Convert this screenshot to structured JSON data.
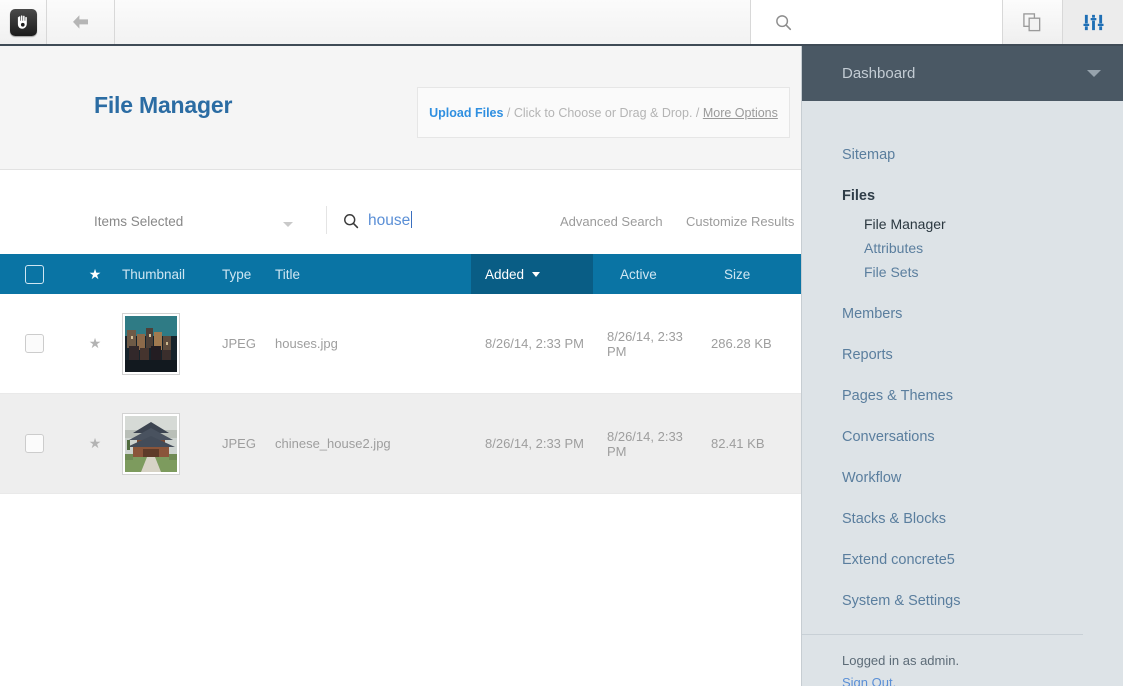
{
  "toolbar": {
    "logo_icon": "concrete5-hand-icon",
    "back_icon": "arrow-left-icon",
    "search_icon": "search-icon",
    "search_placeholder": "",
    "pages_icon": "copy-pages-icon",
    "settings_icon": "sliders-settings-icon",
    "accent_color": "#1f6fb5"
  },
  "page": {
    "title": "File Manager",
    "upload": {
      "link": "Upload Files",
      "separator_1": " / ",
      "hint": "Click to Choose or Drag & Drop.",
      "separator_2": " / ",
      "more": "More Options"
    }
  },
  "filters": {
    "items_selected_label": "Items Selected",
    "items_selected_caret": "chevron-down-icon",
    "search_icon": "search-icon",
    "search_value": "house",
    "advanced_search": "Advanced Search",
    "customize_results": "Customize Results"
  },
  "table": {
    "header_bg": "#0a74a4",
    "sorted_column_bg": "#095d85",
    "columns": {
      "select_all": "",
      "star": "★",
      "thumbnail": "Thumbnail",
      "type": "Type",
      "title": "Title",
      "added": "Added",
      "active": "Active",
      "size": "Size"
    },
    "sorted_by": "Added",
    "rows": [
      {
        "star": "★",
        "thumbnail_alt": "houses-cliffside-thumbnail",
        "type": "JPEG",
        "title": "houses.jpg",
        "added": "8/26/14, 2:33 PM",
        "active": "8/26/14, 2:33 PM",
        "size": "286.28 KB"
      },
      {
        "star": "★",
        "thumbnail_alt": "chinese-temple-thumbnail",
        "type": "JPEG",
        "title": "chinese_house2.jpg",
        "added": "8/26/14, 2:33 PM",
        "active": "8/26/14, 2:33 PM",
        "size": "82.41 KB"
      }
    ]
  },
  "sidebar": {
    "header": {
      "title": "Dashboard",
      "chevron": "chevron-down-icon",
      "bg": "#4a5864"
    },
    "items": [
      {
        "label": "Sitemap"
      },
      {
        "label": "Files"
      },
      {
        "label": "File Manager"
      },
      {
        "label": "Attributes"
      },
      {
        "label": "File Sets"
      },
      {
        "label": "Members"
      },
      {
        "label": "Reports"
      },
      {
        "label": "Pages & Themes"
      },
      {
        "label": "Conversations"
      },
      {
        "label": "Workflow"
      },
      {
        "label": "Stacks & Blocks"
      },
      {
        "label": "Extend concrete5"
      },
      {
        "label": "System & Settings"
      }
    ],
    "footer": {
      "logged_in": "Logged in as admin.",
      "sign_out": "Sign Out."
    }
  }
}
